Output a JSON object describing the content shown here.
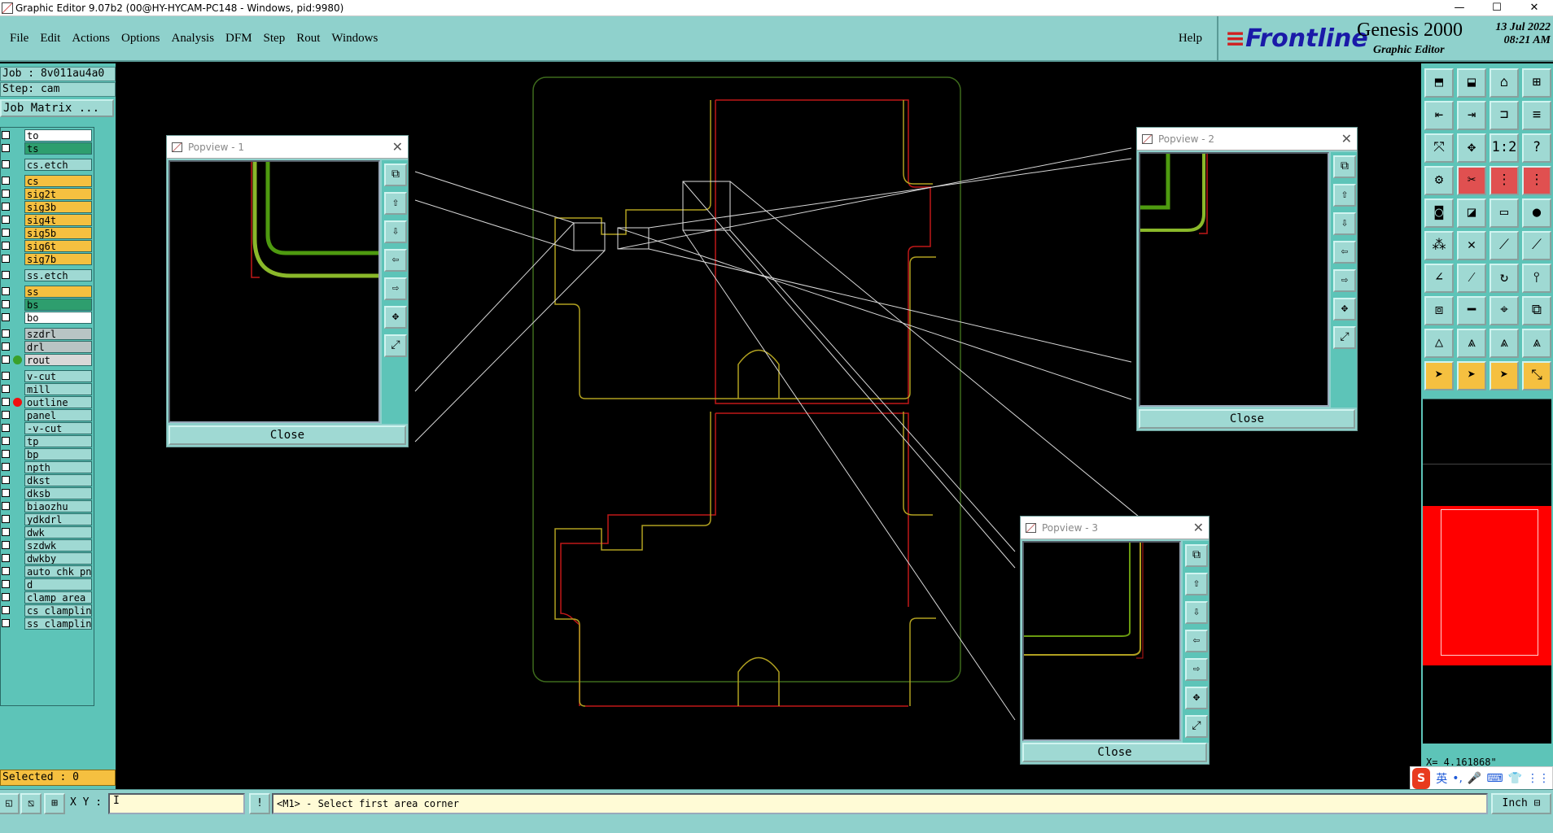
{
  "window": {
    "title": "Graphic Editor 9.07b2 (00@HY-HYCAM-PC148 - Windows, pid:9980)",
    "minimize": "—",
    "maximize": "☐",
    "close": "✕"
  },
  "menu": {
    "items": [
      "File",
      "Edit",
      "Actions",
      "Options",
      "Analysis",
      "DFM",
      "Step",
      "Rout",
      "Windows"
    ],
    "help": "Help"
  },
  "brand": {
    "logo_bars": "≡",
    "logo": "Frontline",
    "product": "Genesis 2000",
    "subtitle": "Graphic Editor",
    "date": "13 Jul 2022",
    "time": "08:21 AM"
  },
  "job": {
    "job_line": "Job : 8v011au4a0",
    "step_line": "Step: cam",
    "matrix_button": "Job Matrix ..."
  },
  "layers": [
    {
      "name": "to",
      "bg": "#ffffff",
      "dot": ""
    },
    {
      "name": "ts",
      "bg": "#2e9e6e",
      "dot": ""
    },
    {
      "name": "cs.etch",
      "bg": "#9fd9d3",
      "dot": ""
    },
    {
      "name": "cs",
      "bg": "#f5c040",
      "dot": ""
    },
    {
      "name": "sig2t",
      "bg": "#f5c040",
      "dot": ""
    },
    {
      "name": "sig3b",
      "bg": "#f5c040",
      "dot": ""
    },
    {
      "name": "sig4t",
      "bg": "#f5c040",
      "dot": ""
    },
    {
      "name": "sig5b",
      "bg": "#f5c040",
      "dot": ""
    },
    {
      "name": "sig6t",
      "bg": "#f5c040",
      "dot": ""
    },
    {
      "name": "sig7b",
      "bg": "#f5c040",
      "dot": ""
    },
    {
      "name": "ss.etch",
      "bg": "#9fd9d3",
      "dot": ""
    },
    {
      "name": "ss",
      "bg": "#f5c040",
      "dot": ""
    },
    {
      "name": "bs",
      "bg": "#2e9e6e",
      "dot": ""
    },
    {
      "name": "bo",
      "bg": "#ffffff",
      "dot": ""
    },
    {
      "name": "szdrl",
      "bg": "#b8c4c4",
      "dot": ""
    },
    {
      "name": "drl",
      "bg": "#b8c4c4",
      "dot": ""
    },
    {
      "name": "rout",
      "bg": "#d8d8d8",
      "dot": "#3aa02a"
    },
    {
      "name": "v-cut",
      "bg": "#9fd9d3",
      "dot": ""
    },
    {
      "name": "mill",
      "bg": "#9fd9d3",
      "dot": ""
    },
    {
      "name": "outline",
      "bg": "#9fd9d3",
      "dot": "#f01010"
    },
    {
      "name": "panel",
      "bg": "#9fd9d3",
      "dot": ""
    },
    {
      "name": "-v-cut",
      "bg": "#9fd9d3",
      "dot": ""
    },
    {
      "name": "tp",
      "bg": "#9fd9d3",
      "dot": ""
    },
    {
      "name": "bp",
      "bg": "#9fd9d3",
      "dot": ""
    },
    {
      "name": "npth",
      "bg": "#9fd9d3",
      "dot": ""
    },
    {
      "name": "dkst",
      "bg": "#9fd9d3",
      "dot": ""
    },
    {
      "name": "dksb",
      "bg": "#9fd9d3",
      "dot": ""
    },
    {
      "name": "biaozhu",
      "bg": "#9fd9d3",
      "dot": ""
    },
    {
      "name": "ydkdrl",
      "bg": "#9fd9d3",
      "dot": ""
    },
    {
      "name": "dwk",
      "bg": "#9fd9d3",
      "dot": ""
    },
    {
      "name": "szdwk",
      "bg": "#9fd9d3",
      "dot": ""
    },
    {
      "name": "dwkby",
      "bg": "#9fd9d3",
      "dot": ""
    },
    {
      "name": "auto_chk_pn",
      "bg": "#9fd9d3",
      "dot": ""
    },
    {
      "name": "d",
      "bg": "#9fd9d3",
      "dot": ""
    },
    {
      "name": "clamp_area",
      "bg": "#9fd9d3",
      "dot": ""
    },
    {
      "name": "cs_clampline",
      "bg": "#9fd9d3",
      "dot": ""
    },
    {
      "name": "ss_clampline",
      "bg": "#9fd9d3",
      "dot": ""
    }
  ],
  "selected": "Selected : 0",
  "popviews": [
    {
      "title": "Popview - 1",
      "close": "Close",
      "close_icon": "✕"
    },
    {
      "title": "Popview - 2",
      "close": "Close",
      "close_icon": "✕"
    },
    {
      "title": "Popview - 3",
      "close": "Close",
      "close_icon": "✕"
    }
  ],
  "popview_tools": [
    "⧉",
    "⇧",
    "⇩",
    "⇦",
    "⇨",
    "✥",
    "⤢"
  ],
  "toolbox": {
    "rows": [
      [
        "⬒",
        "⬓",
        "⌂",
        "⊞"
      ],
      [
        "⇤",
        "⇥",
        "⊐",
        "≡"
      ],
      [
        "⤧",
        "✥",
        "1:2",
        "?"
      ],
      [
        "⚙",
        "✂",
        "⋮",
        "⋮"
      ],
      [
        "◙",
        "◪",
        "▭",
        "●"
      ],
      [
        "⁂",
        "✕",
        "⟋",
        "⟋"
      ],
      [
        "∠",
        "⁄",
        "↻",
        "⫯"
      ],
      [
        "⧈",
        "━",
        "⌖",
        "⧉"
      ],
      [
        "△",
        "⩓",
        "⩓",
        "⩓"
      ],
      [
        "➤",
        "➤",
        "➤",
        "⤡"
      ]
    ]
  },
  "coord_readout": "X= 4.161868\"",
  "ime": {
    "logo": "S",
    "items": [
      "英",
      "•,",
      "🎤",
      "⌨",
      "👕",
      "⋮⋮"
    ]
  },
  "bottom": {
    "xy_label": "X Y :",
    "xy_value": "I",
    "prompt": "<M1> - Select first area corner",
    "units": "Inch ⊟"
  }
}
